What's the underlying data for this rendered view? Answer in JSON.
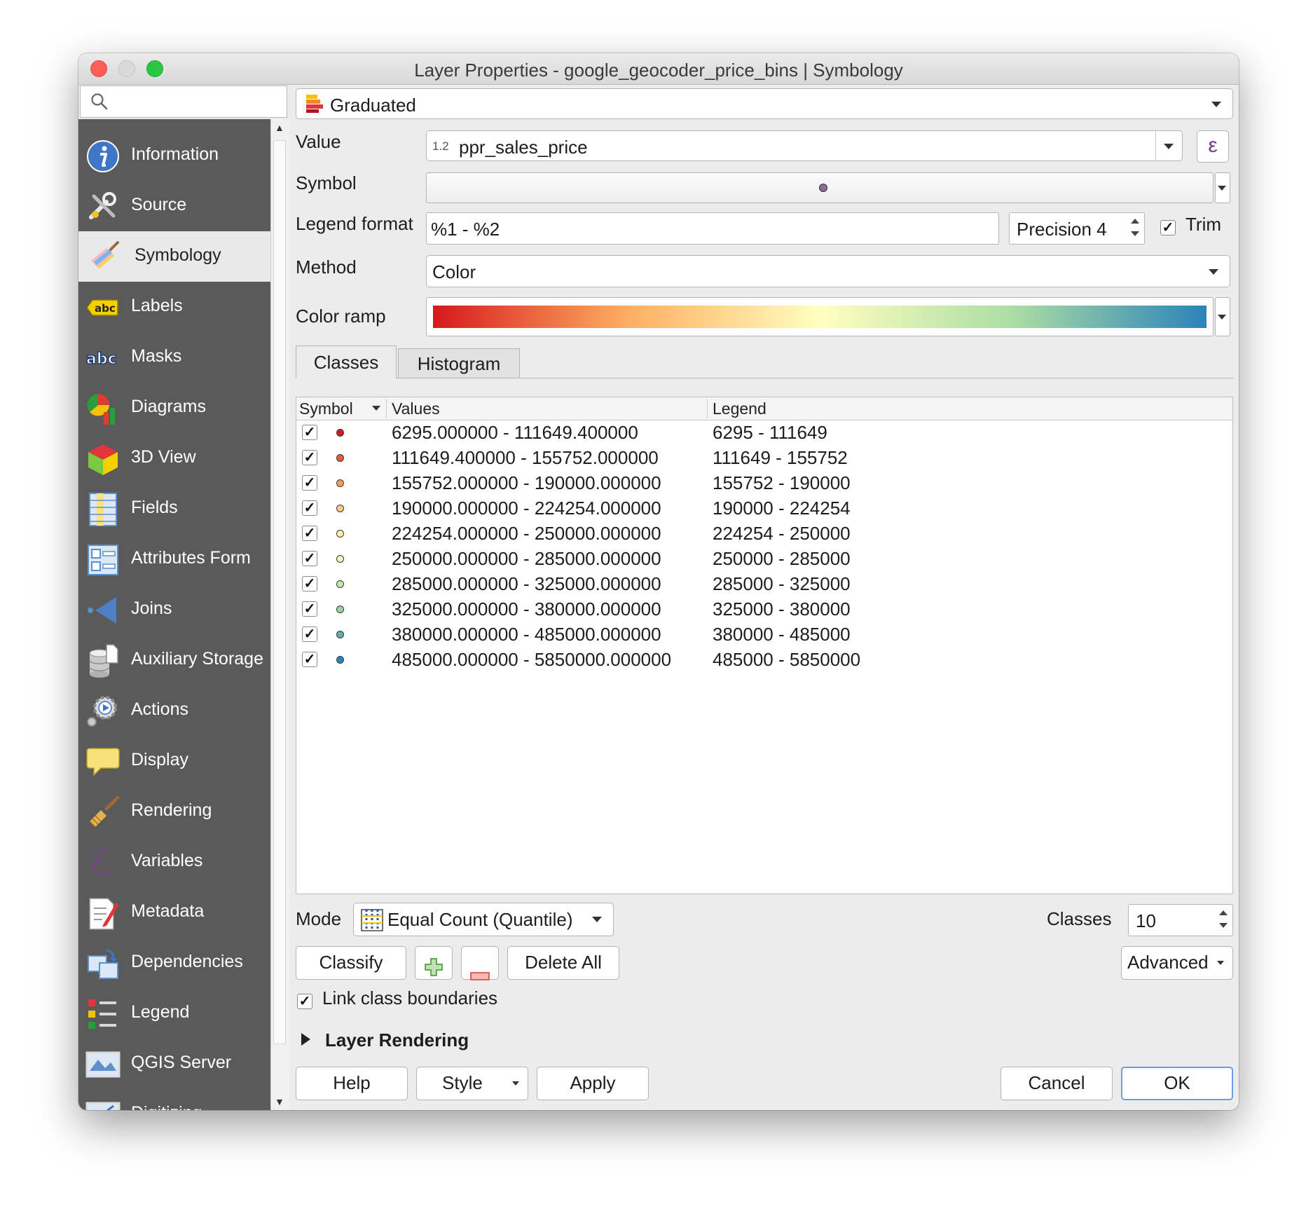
{
  "window": {
    "title": "Layer Properties - google_geocoder_price_bins | Symbology"
  },
  "search": {
    "placeholder": ""
  },
  "sidebar": {
    "items": [
      {
        "label": "Information",
        "icon": "info-icon"
      },
      {
        "label": "Source",
        "icon": "source-tools-icon"
      },
      {
        "label": "Symbology",
        "icon": "paintbrush-icon"
      },
      {
        "label": "Labels",
        "icon": "labels-abc-icon"
      },
      {
        "label": "Masks",
        "icon": "masks-abc-icon"
      },
      {
        "label": "Diagrams",
        "icon": "diagram-icon"
      },
      {
        "label": "3D View",
        "icon": "cube-icon"
      },
      {
        "label": "Fields",
        "icon": "fields-table-icon"
      },
      {
        "label": "Attributes Form",
        "icon": "form-icon"
      },
      {
        "label": "Joins",
        "icon": "join-icon"
      },
      {
        "label": "Auxiliary Storage",
        "icon": "database-icon"
      },
      {
        "label": "Actions",
        "icon": "gear-play-icon"
      },
      {
        "label": "Display",
        "icon": "speech-bubble-icon"
      },
      {
        "label": "Rendering",
        "icon": "brush-icon"
      },
      {
        "label": "Variables",
        "icon": "epsilon-icon"
      },
      {
        "label": "Metadata",
        "icon": "document-pen-icon"
      },
      {
        "label": "Dependencies",
        "icon": "dependencies-icon"
      },
      {
        "label": "Legend",
        "icon": "legend-icon"
      },
      {
        "label": "QGIS Server",
        "icon": "map-server-icon"
      },
      {
        "label": "Digitizing",
        "icon": "digitizing-icon"
      }
    ],
    "active": "Symbology"
  },
  "renderer": {
    "type": "Graduated"
  },
  "form": {
    "value_label": "Value",
    "value_type": "1.2",
    "value_field": "ppr_sales_price",
    "symbol_label": "Symbol",
    "legend_format_label": "Legend format",
    "legend_format": "%1 - %2",
    "precision": "Precision 4",
    "trim_label": "Trim",
    "method_label": "Method",
    "method": "Color",
    "color_ramp_label": "Color ramp",
    "color_ramp_colors": [
      "#d7191c",
      "#fdae61",
      "#ffffbf",
      "#abdda4",
      "#2b83ba"
    ]
  },
  "tabs": {
    "classes": "Classes",
    "histogram": "Histogram"
  },
  "table": {
    "headers": {
      "symbol": "Symbol",
      "values": "Values",
      "legend": "Legend"
    },
    "rows": [
      {
        "values": "6295.000000 - 111649.400000",
        "legend": "6295 - 111649",
        "color": "#d7191c"
      },
      {
        "values": "111649.400000 - 155752.000000",
        "legend": "111649 - 155752",
        "color": "#e85b3a"
      },
      {
        "values": "155752.000000 - 190000.000000",
        "legend": "155752 - 190000",
        "color": "#f99e59"
      },
      {
        "values": "190000.000000 - 224254.000000",
        "legend": "190000 - 224254",
        "color": "#fec980"
      },
      {
        "values": "224254.000000 - 250000.000000",
        "legend": "224254 - 250000",
        "color": "#ffedaa"
      },
      {
        "values": "250000.000000 - 285000.000000",
        "legend": "250000 - 285000",
        "color": "#ecf7b9"
      },
      {
        "values": "285000.000000 - 325000.000000",
        "legend": "285000 - 325000",
        "color": "#c4e6a7"
      },
      {
        "values": "325000.000000 - 380000.000000",
        "legend": "325000 - 380000",
        "color": "#9dd3a7"
      },
      {
        "values": "380000.000000 - 485000.000000",
        "legend": "380000 - 485000",
        "color": "#64abb0"
      },
      {
        "values": "485000.000000 - 5850000.000000",
        "legend": "485000 - 5850000",
        "color": "#2b83ba"
      }
    ]
  },
  "mode": {
    "label": "Mode",
    "value": "Equal Count (Quantile)"
  },
  "classes": {
    "label": "Classes",
    "value": "10"
  },
  "buttons": {
    "classify": "Classify",
    "delete_all": "Delete All",
    "advanced": "Advanced",
    "help": "Help",
    "style": "Style",
    "apply": "Apply",
    "cancel": "Cancel",
    "ok": "OK"
  },
  "link_class_boundaries": "Link class boundaries",
  "layer_rendering": "Layer Rendering"
}
